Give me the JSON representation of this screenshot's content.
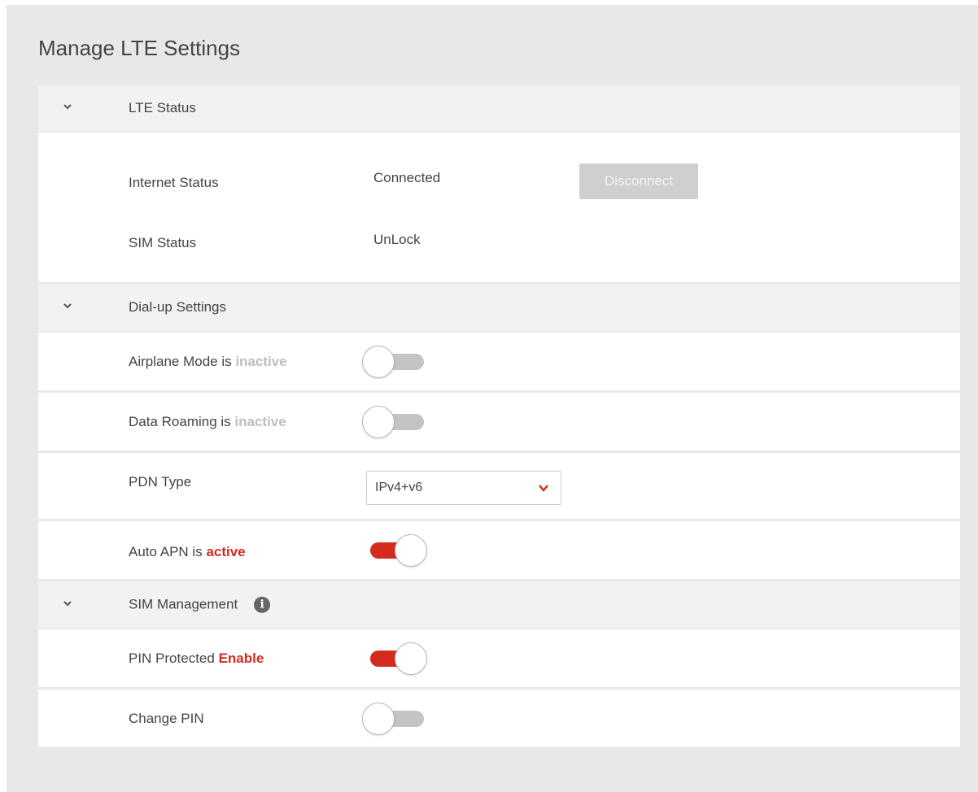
{
  "page": {
    "title": "Manage LTE Settings"
  },
  "lte_status": {
    "header": "LTE Status",
    "internet_status_label": "Internet Status",
    "internet_status_value": "Connected",
    "disconnect_label": "Disconnect",
    "sim_status_label": "SIM Status",
    "sim_status_value": "UnLock"
  },
  "dialup": {
    "header": "Dial-up Settings",
    "airplane_prefix": "Airplane Mode is ",
    "airplane_state": "inactive",
    "airplane_on": false,
    "roaming_prefix": "Data Roaming is ",
    "roaming_state": "inactive",
    "roaming_on": false,
    "pdn_label": "PDN Type",
    "pdn_value": "IPv4+v6",
    "auto_apn_prefix": "Auto APN is ",
    "auto_apn_state": "active",
    "auto_apn_on": true
  },
  "sim_mgmt": {
    "header": "SIM Management",
    "info_icon": "info-circle-icon",
    "pin_prefix": "PIN Protected ",
    "pin_state": "Enable",
    "pin_on": true,
    "change_pin_label": "Change PIN",
    "change_pin_on": false
  },
  "colors": {
    "accent": "#d52b1e",
    "inactive_text": "#bdbdbd",
    "toggle_off": "#c4c4c4",
    "background": "#e8e8e8"
  }
}
